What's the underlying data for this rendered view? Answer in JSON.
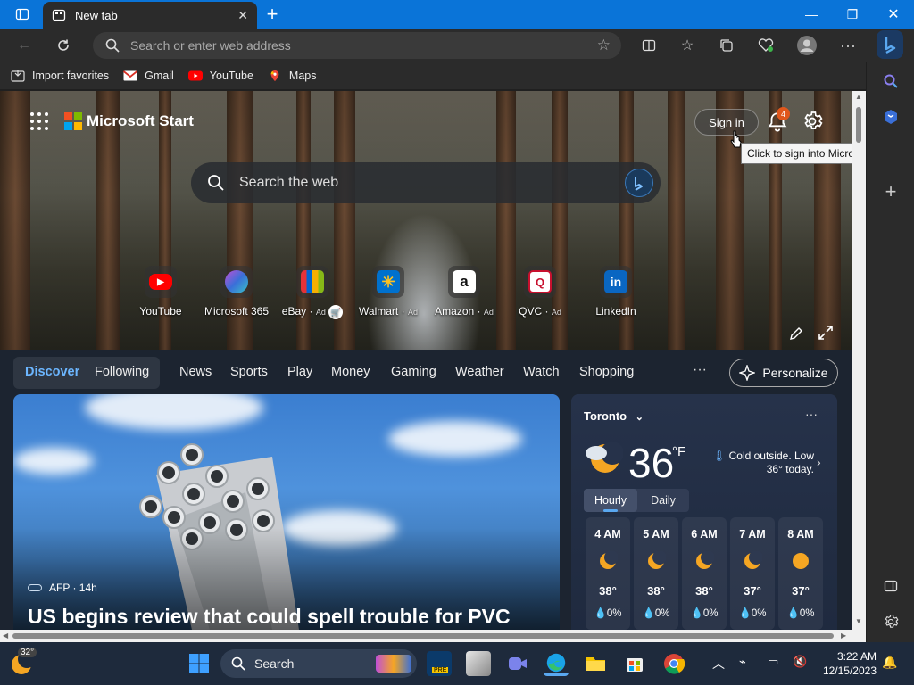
{
  "browser": {
    "tab_title": "New tab",
    "address_placeholder": "Search or enter web address",
    "favorites": [
      {
        "label": "Import favorites",
        "icon": "import-icon"
      },
      {
        "label": "Gmail",
        "icon": "gmail-icon"
      },
      {
        "label": "YouTube",
        "icon": "youtube-icon"
      },
      {
        "label": "Maps",
        "icon": "maps-icon"
      }
    ]
  },
  "header": {
    "brand": "Microsoft Start",
    "sign_in": "Sign in",
    "notification_count": "4",
    "tooltip": "Click to sign into Microsoft Edge"
  },
  "search": {
    "placeholder": "Search the web"
  },
  "quick_links": [
    {
      "label": "YouTube",
      "ad": ""
    },
    {
      "label": "Microsoft 365",
      "ad": ""
    },
    {
      "label": "eBay",
      "ad": "Ad"
    },
    {
      "label": "Walmart",
      "ad": "Ad"
    },
    {
      "label": "Amazon",
      "ad": "Ad"
    },
    {
      "label": "QVC",
      "ad": "Ad"
    },
    {
      "label": "LinkedIn",
      "ad": ""
    }
  ],
  "feed_nav": {
    "discover": "Discover",
    "following": "Following",
    "items": [
      "News",
      "Sports",
      "Play",
      "Money",
      "Gaming",
      "Weather",
      "Watch",
      "Shopping"
    ],
    "more": "···",
    "personalize": "Personalize"
  },
  "article": {
    "source": "AFP · 14h",
    "title": "US begins review that could spell trouble for PVC"
  },
  "weather": {
    "city": "Toronto",
    "temp": "36",
    "unit": "°F",
    "note": "Cold outside. Low 36° today.",
    "tab_hourly": "Hourly",
    "tab_daily": "Daily",
    "hours": [
      {
        "time": "4 AM",
        "temp": "38°",
        "precip": "0%",
        "icon": "moon-icon"
      },
      {
        "time": "5 AM",
        "temp": "38°",
        "precip": "0%",
        "icon": "moon-icon"
      },
      {
        "time": "6 AM",
        "temp": "38°",
        "precip": "0%",
        "icon": "moon-icon"
      },
      {
        "time": "7 AM",
        "temp": "37°",
        "precip": "0%",
        "icon": "moon-icon"
      },
      {
        "time": "8 AM",
        "temp": "37°",
        "precip": "0%",
        "icon": "sun-icon"
      }
    ]
  },
  "taskbar": {
    "weather_temp": "32°",
    "search_placeholder": "Search",
    "time": "3:22 AM",
    "date": "12/15/2023"
  },
  "colors": {
    "titlebar": "#0a74d8",
    "accent_blue": "#5aa8f0",
    "badge": "#e0571c"
  }
}
